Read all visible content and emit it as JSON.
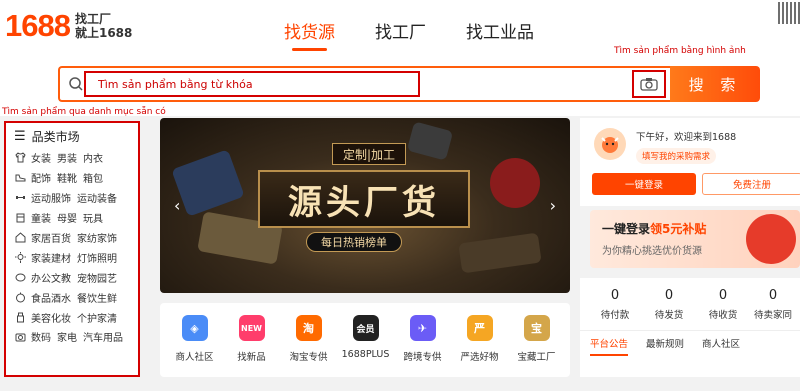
{
  "logo": {
    "number": "1688",
    "line1": "找工厂",
    "line2": "就上1688"
  },
  "nav": [
    {
      "label": "找货源",
      "active": true
    },
    {
      "label": "找工厂",
      "active": false
    },
    {
      "label": "找工业品",
      "active": false
    }
  ],
  "annotations": {
    "image_search": "Tìm sản phẩm bằng hình ảnh",
    "category_search": "Tìm sản phẩm qua danh mục sẵn có"
  },
  "search": {
    "placeholder": "Tìm sản phẩm bằng từ khóa",
    "button_label": "搜 索",
    "camera_icon": "camera-icon"
  },
  "categories": {
    "title": "品类市场",
    "rows": [
      {
        "icon": "clothing-icon",
        "items": [
          "女装",
          "男装",
          "内衣"
        ]
      },
      {
        "icon": "shoe-icon",
        "items": [
          "配饰",
          "鞋靴",
          "箱包"
        ]
      },
      {
        "icon": "sport-icon",
        "items": [
          "运动服饰",
          "运动装备"
        ]
      },
      {
        "icon": "kids-icon",
        "items": [
          "童装",
          "母婴",
          "玩具"
        ]
      },
      {
        "icon": "home-icon",
        "items": [
          "家居百货",
          "家纺家饰"
        ]
      },
      {
        "icon": "light-icon",
        "items": [
          "家装建材",
          "灯饰照明"
        ]
      },
      {
        "icon": "office-icon",
        "items": [
          "办公文教",
          "宠物园艺"
        ]
      },
      {
        "icon": "food-icon",
        "items": [
          "食品酒水",
          "餐饮生鲜"
        ]
      },
      {
        "icon": "beauty-icon",
        "items": [
          "美容化妆",
          "个护家清"
        ]
      },
      {
        "icon": "digital-icon",
        "items": [
          "数码",
          "家电",
          "汽车用品"
        ]
      }
    ]
  },
  "banner": {
    "tag": "定制|加工",
    "title": "源头厂货",
    "subtitle": "每日热销榜单"
  },
  "services": [
    {
      "label": "商人社区",
      "icon": "community-icon",
      "color": "#4a8cf7",
      "glyph": "◈"
    },
    {
      "label": "找新品",
      "icon": "new-icon",
      "color": "#ff3d6b",
      "glyph": "NEW"
    },
    {
      "label": "淘宝专供",
      "icon": "taobao-icon",
      "color": "#ff6a00",
      "glyph": "淘"
    },
    {
      "label": "1688PLUS",
      "icon": "plus-icon",
      "color": "#222222",
      "glyph": "会员"
    },
    {
      "label": "跨境专供",
      "icon": "plane-icon",
      "color": "#6b5cf6",
      "glyph": "✈"
    },
    {
      "label": "严选好物",
      "icon": "select-icon",
      "color": "#f5a623",
      "glyph": "严"
    },
    {
      "label": "宝藏工厂",
      "icon": "factory-icon",
      "color": "#d4a64a",
      "glyph": "宝"
    }
  ],
  "user": {
    "greeting": "下午好，欢迎来到1688",
    "need_link": "填写我的采购需求",
    "login_label": "一键登录",
    "register_label": "免费注册"
  },
  "promo": {
    "line1_prefix": "一键登录",
    "line1_highlight": "领5元补贴",
    "line2": "为你精心挑选优价货源"
  },
  "stats": [
    {
      "value": "0",
      "label": "待付款"
    },
    {
      "value": "0",
      "label": "待发货"
    },
    {
      "value": "0",
      "label": "待收货"
    },
    {
      "value": "0",
      "label": "待卖家同"
    }
  ],
  "tabs": [
    {
      "label": "平台公告",
      "active": true
    },
    {
      "label": "最新规则",
      "active": false
    },
    {
      "label": "商人社区",
      "active": false
    }
  ],
  "colors": {
    "brand": "#ff4400",
    "annotation": "#d40000"
  }
}
